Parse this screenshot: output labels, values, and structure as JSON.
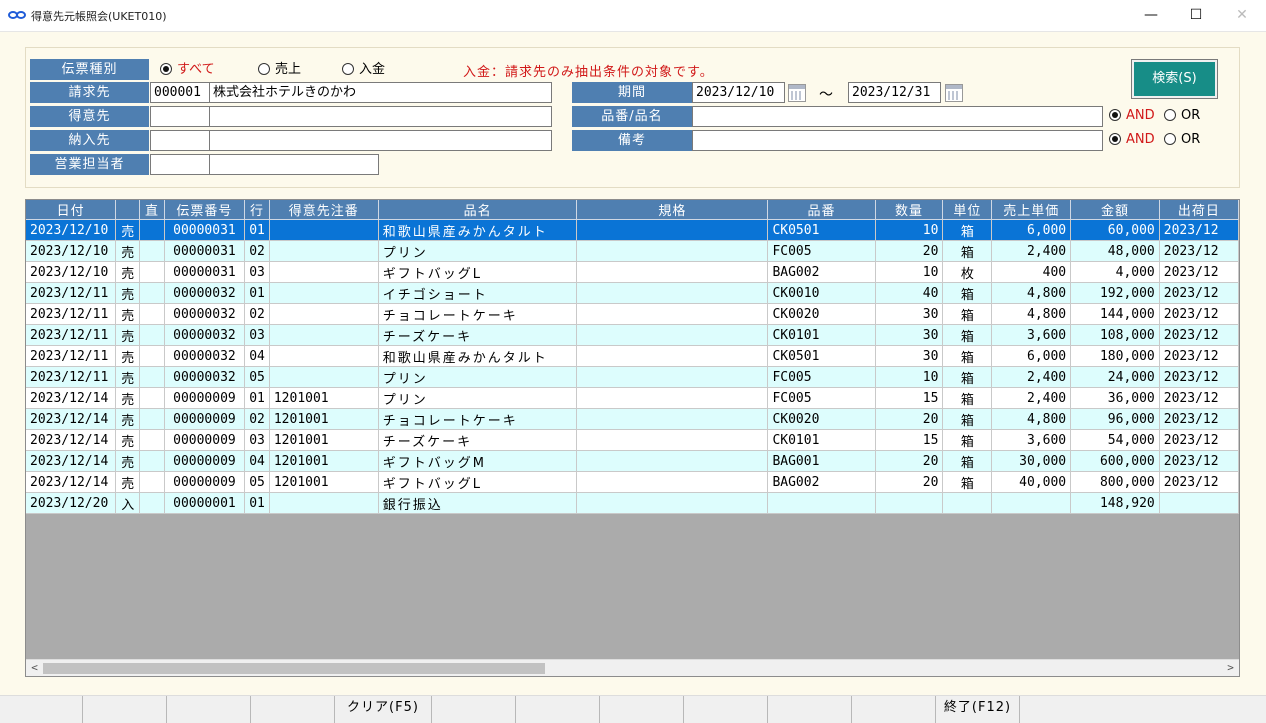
{
  "window": {
    "title": "得意先元帳照会(UKET010)",
    "min_glyph": "—",
    "max_glyph": "☐",
    "close_glyph": "✕"
  },
  "form": {
    "denpyo_label": "伝票種別",
    "radio_all": "すべて",
    "radio_sales": "売上",
    "radio_payment": "入金",
    "note": "入金：請求先のみ抽出条件の対象です。",
    "seikyu_label": "請求先",
    "seikyu_code": "000001",
    "seikyu_name": "株式会社ホテルきのかわ",
    "tokui_label": "得意先",
    "tokui_code": "",
    "tokui_name": "",
    "nonyu_label": "納入先",
    "nonyu_code": "",
    "nonyu_name": "",
    "tanto_label": "営業担当者",
    "tanto_code": "",
    "tanto_name": "",
    "kikan_label": "期間",
    "date_from": "2023/12/10",
    "tilde": "～",
    "date_to": "2023/12/31",
    "hinban_label": "品番/品名",
    "hinban_value": "",
    "biko_label": "備考",
    "biko_value": "",
    "and_label": "AND",
    "or_label": "OR",
    "search_label": "検索(S)"
  },
  "grid": {
    "columns": [
      "日付",
      "",
      "直",
      "伝票番号",
      "行",
      "得意先注番",
      "品名",
      "規格",
      "品番",
      "数量",
      "単位",
      "売上単価",
      "金額",
      "出荷日"
    ],
    "rows": [
      [
        "2023/12/10",
        "売",
        "",
        "00000031",
        "01",
        "",
        "和歌山県産みかんタルト",
        "",
        "CK0501",
        "10",
        "箱",
        "6,000",
        "60,000",
        "2023/12"
      ],
      [
        "2023/12/10",
        "売",
        "",
        "00000031",
        "02",
        "",
        "プリン",
        "",
        "FC005",
        "20",
        "箱",
        "2,400",
        "48,000",
        "2023/12"
      ],
      [
        "2023/12/10",
        "売",
        "",
        "00000031",
        "03",
        "",
        "ギフトバッグL",
        "",
        "BAG002",
        "10",
        "枚",
        "400",
        "4,000",
        "2023/12"
      ],
      [
        "2023/12/11",
        "売",
        "",
        "00000032",
        "01",
        "",
        "イチゴショート",
        "",
        "CK0010",
        "40",
        "箱",
        "4,800",
        "192,000",
        "2023/12"
      ],
      [
        "2023/12/11",
        "売",
        "",
        "00000032",
        "02",
        "",
        "チョコレートケーキ",
        "",
        "CK0020",
        "30",
        "箱",
        "4,800",
        "144,000",
        "2023/12"
      ],
      [
        "2023/12/11",
        "売",
        "",
        "00000032",
        "03",
        "",
        "チーズケーキ",
        "",
        "CK0101",
        "30",
        "箱",
        "3,600",
        "108,000",
        "2023/12"
      ],
      [
        "2023/12/11",
        "売",
        "",
        "00000032",
        "04",
        "",
        "和歌山県産みかんタルト",
        "",
        "CK0501",
        "30",
        "箱",
        "6,000",
        "180,000",
        "2023/12"
      ],
      [
        "2023/12/11",
        "売",
        "",
        "00000032",
        "05",
        "",
        "プリン",
        "",
        "FC005",
        "10",
        "箱",
        "2,400",
        "24,000",
        "2023/12"
      ],
      [
        "2023/12/14",
        "売",
        "",
        "00000009",
        "01",
        "1201001",
        "プリン",
        "",
        "FC005",
        "15",
        "箱",
        "2,400",
        "36,000",
        "2023/12"
      ],
      [
        "2023/12/14",
        "売",
        "",
        "00000009",
        "02",
        "1201001",
        "チョコレートケーキ",
        "",
        "CK0020",
        "20",
        "箱",
        "4,800",
        "96,000",
        "2023/12"
      ],
      [
        "2023/12/14",
        "売",
        "",
        "00000009",
        "03",
        "1201001",
        "チーズケーキ",
        "",
        "CK0101",
        "15",
        "箱",
        "3,600",
        "54,000",
        "2023/12"
      ],
      [
        "2023/12/14",
        "売",
        "",
        "00000009",
        "04",
        "1201001",
        "ギフトバッグM",
        "",
        "BAG001",
        "20",
        "箱",
        "30,000",
        "600,000",
        "2023/12"
      ],
      [
        "2023/12/14",
        "売",
        "",
        "00000009",
        "05",
        "1201001",
        "ギフトバッグL",
        "",
        "BAG002",
        "20",
        "箱",
        "40,000",
        "800,000",
        "2023/12"
      ],
      [
        "2023/12/20",
        "入",
        "",
        "00000001",
        "01",
        "",
        "銀行振込",
        "",
        "",
        "",
        "",
        "",
        "148,920",
        ""
      ]
    ]
  },
  "scroll": {
    "left_arrow": "<",
    "right_arrow": ">"
  },
  "statusbar": {
    "keys": [
      "",
      "",
      "",
      "",
      "クリア(F5)",
      "",
      "",
      "",
      "",
      "",
      "",
      "終了(F12)",
      ""
    ]
  }
}
